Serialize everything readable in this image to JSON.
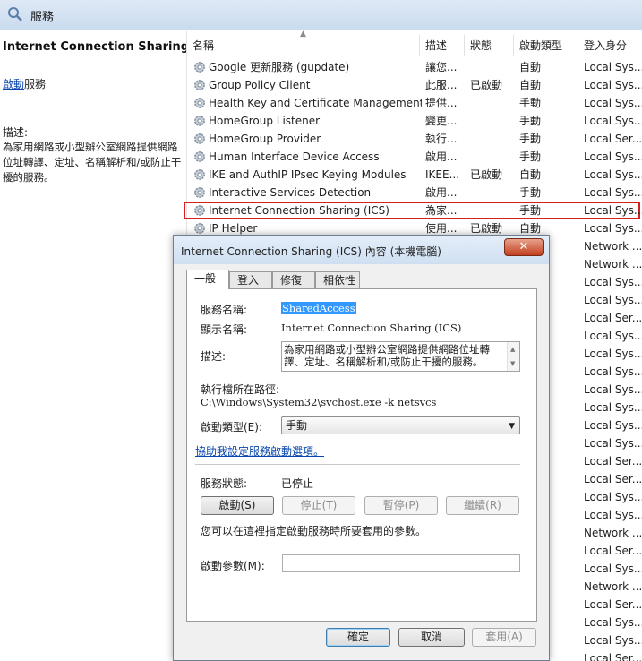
{
  "window": {
    "title": "服務",
    "icon": "gear-magnifier-icon"
  },
  "left_panel": {
    "service_title": "Internet Connection Sharing (ICS)",
    "start_link": "啟動",
    "start_suffix": "服務",
    "desc_label": "描述:",
    "desc_text": "為家用網路或小型辦公室網路提供網路位址轉譯、定址、名稱解析和/或防止干擾的服務。"
  },
  "columns": {
    "name": "名稱",
    "desc": "描述",
    "status": "狀態",
    "start_type": "啟動類型",
    "logon": "登入身分"
  },
  "rows": [
    {
      "name": "Google 更新服務 (gupdate)",
      "desc": "讓您...",
      "status": "",
      "start_type": "自動",
      "logon": "Local Sys..."
    },
    {
      "name": "Group Policy Client",
      "desc": "此服...",
      "status": "已啟動",
      "start_type": "自動",
      "logon": "Local Sys..."
    },
    {
      "name": "Health Key and Certificate Management",
      "desc": "提供...",
      "status": "",
      "start_type": "手動",
      "logon": "Local Sys..."
    },
    {
      "name": "HomeGroup Listener",
      "desc": "變更...",
      "status": "",
      "start_type": "手動",
      "logon": "Local Sys..."
    },
    {
      "name": "HomeGroup Provider",
      "desc": "執行...",
      "status": "",
      "start_type": "手動",
      "logon": "Local Ser..."
    },
    {
      "name": "Human Interface Device Access",
      "desc": "啟用...",
      "status": "",
      "start_type": "手動",
      "logon": "Local Sys..."
    },
    {
      "name": "IKE and AuthIP IPsec Keying Modules",
      "desc": "IKEE...",
      "status": "已啟動",
      "start_type": "自動",
      "logon": "Local Sys..."
    },
    {
      "name": "Interactive Services Detection",
      "desc": "啟用...",
      "status": "",
      "start_type": "手動",
      "logon": "Local Sys..."
    },
    {
      "name": "Internet Connection Sharing (ICS)",
      "desc": "為家...",
      "status": "",
      "start_type": "手動",
      "logon": "Local Sys..."
    },
    {
      "name": "IP Helper",
      "desc": "使用...",
      "status": "已啟動",
      "start_type": "自動",
      "logon": "Local Sys..."
    }
  ],
  "logon_column_rest": [
    "Network ...",
    "Network ...",
    "Local Sys...",
    "Local Sys...",
    "Local Ser...",
    "Local Sys...",
    "Local Sys...",
    "Local Sys...",
    "Local Sys...",
    "Local Sys...",
    "Local Sys...",
    "Local Sys...",
    "Local Ser...",
    "Local Ser...",
    "Local Sys...",
    "Local Sys...",
    "Network ...",
    "Local Ser...",
    "Local Sys...",
    "Network ...",
    "Local Ser...",
    "Local Sys...",
    "Local Sys...",
    "Local Ser...",
    "Local Ser..."
  ],
  "dialog": {
    "title": "Internet Connection Sharing (ICS) 內容 (本機電腦)",
    "close": "✕",
    "tabs": [
      "一般",
      "登入",
      "修復",
      "相依性"
    ],
    "service_name_label": "服務名稱:",
    "service_name": "SharedAccess",
    "display_name_label": "顯示名稱:",
    "display_name": "Internet Connection Sharing (ICS)",
    "desc_label": "描述:",
    "desc_text": "為家用網路或小型辦公室網路提供網路位址轉譯、定址、名稱解析和/或防止干擾的服務。",
    "path_label": "執行檔所在路徑:",
    "path": "C:\\Windows\\System32\\svchost.exe -k netsvcs",
    "start_type_label": "啟動類型(E):",
    "start_type": "手動",
    "help_link": "協助我設定服務啟動選項。",
    "status_label": "服務狀態:",
    "status": "已停止",
    "buttons": {
      "start": "啟動(S)",
      "stop": "停止(T)",
      "pause": "暫停(P)",
      "resume": "繼續(R)"
    },
    "params_hint": "您可以在這裡指定啟動服務時所要套用的參數。",
    "params_label": "啟動參數(M):",
    "ok": "確定",
    "cancel": "取消",
    "apply": "套用(A)"
  }
}
